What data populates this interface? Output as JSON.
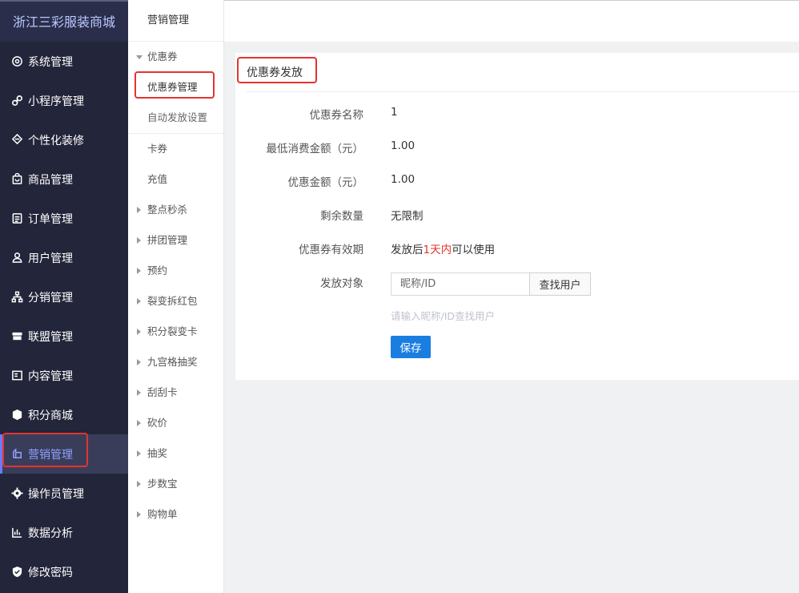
{
  "brand": "浙江三彩服装商城",
  "sidebar": {
    "items": [
      {
        "label": "系统管理",
        "icon": "gear-circle-icon"
      },
      {
        "label": "小程序管理",
        "icon": "mini-program-icon"
      },
      {
        "label": "个性化装修",
        "icon": "decoration-icon"
      },
      {
        "label": "商品管理",
        "icon": "shopping-bag-icon"
      },
      {
        "label": "订单管理",
        "icon": "order-list-icon"
      },
      {
        "label": "用户管理",
        "icon": "user-icon"
      },
      {
        "label": "分销管理",
        "icon": "hierarchy-icon"
      },
      {
        "label": "联盟管理",
        "icon": "store-icon"
      },
      {
        "label": "内容管理",
        "icon": "content-icon"
      },
      {
        "label": "积分商城",
        "icon": "cube-icon"
      },
      {
        "label": "营销管理",
        "icon": "marketing-icon",
        "active": true
      },
      {
        "label": "操作员管理",
        "icon": "gear-icon"
      },
      {
        "label": "数据分析",
        "icon": "bar-chart-icon"
      },
      {
        "label": "修改密码",
        "icon": "shield-check-icon"
      }
    ]
  },
  "submenu": {
    "title": "营销管理",
    "coupon_group": "优惠券",
    "coupon_manage": "优惠券管理",
    "auto_send": "自动发放设置",
    "card": "卡券",
    "recharge": "充值",
    "groups": [
      "整点秒杀",
      "拼团管理",
      "预约",
      "裂变拆红包",
      "积分裂变卡",
      "九宫格抽奖",
      "刮刮卡",
      "砍价",
      "抽奖",
      "步数宝",
      "购物单"
    ]
  },
  "form": {
    "title": "优惠券发放",
    "name_label": "优惠券名称",
    "name_value": "1",
    "min_label": "最低消费金额（元）",
    "min_value": "1.00",
    "discount_label": "优惠金额（元）",
    "discount_value": "1.00",
    "remaining_label": "剩余数量",
    "remaining_value": "无限制",
    "validity_label": "优惠券有效期",
    "validity_prefix": "发放后",
    "validity_days": "1天内",
    "validity_suffix": "可以使用",
    "target_label": "发放对象",
    "search_placeholder": "昵称/ID",
    "search_value": "",
    "search_button": "查找用户",
    "hint": "请输入昵称/ID查找用户",
    "save_button": "保存"
  },
  "colors": {
    "sidebar_bg": "#23253a",
    "accent": "#1a7ee0",
    "highlight": "#e3342f",
    "active_text": "#8fa0ff"
  }
}
